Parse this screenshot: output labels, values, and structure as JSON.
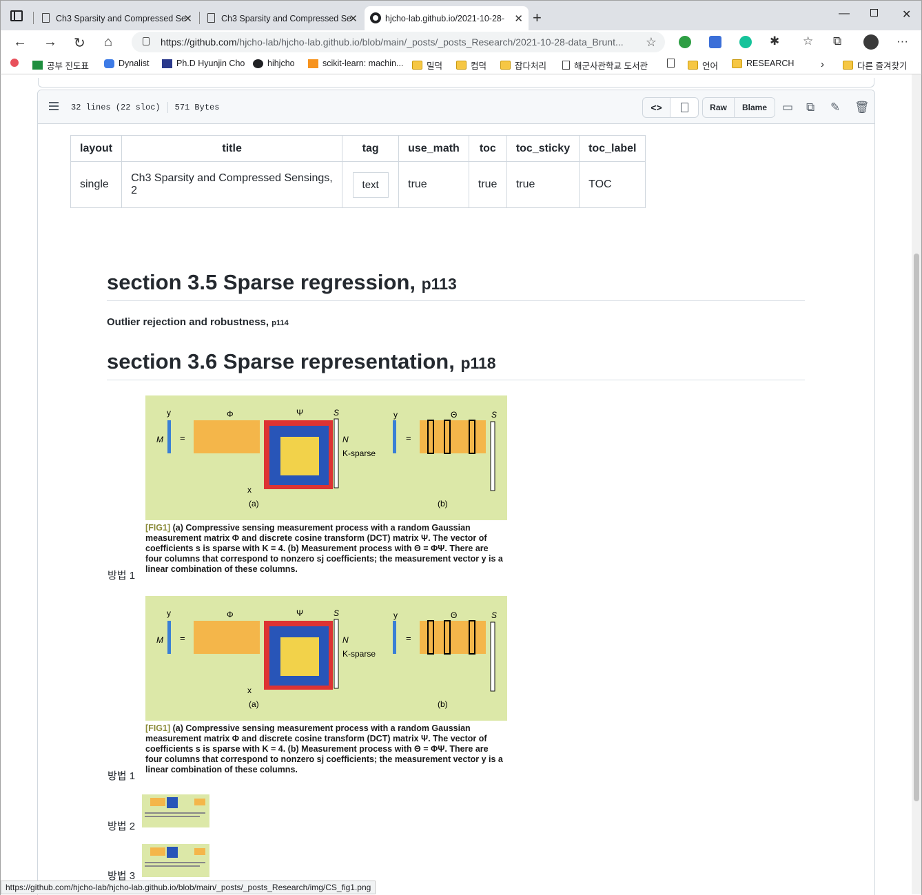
{
  "browser": {
    "tabs": [
      {
        "title": "Ch3 Sparsity and Compressed Se"
      },
      {
        "title": "Ch3 Sparsity and Compressed Se"
      },
      {
        "title": "hjcho-lab.github.io/2021-10-28-"
      }
    ],
    "url_host": "https://github.com",
    "url_path": "/hjcho-lab/hjcho-lab.github.io/blob/main/_posts/_posts_Research/2021-10-28-data_Brunt...",
    "bookmarks": [
      {
        "label": "공부 진도표"
      },
      {
        "label": "Dynalist"
      },
      {
        "label": "Ph.D Hyunjin Cho"
      },
      {
        "label": "hihjcho"
      },
      {
        "label": "scikit-learn: machin..."
      },
      {
        "label": "밀덕"
      },
      {
        "label": "컴덕"
      },
      {
        "label": "잡다처리"
      },
      {
        "label": "해군사관학교 도서관"
      },
      {
        "label": "언어"
      },
      {
        "label": "RESEARCH"
      }
    ],
    "other_bookmarks": "다른 즐겨찾기",
    "status_url": "https://github.com/hjcho-lab/hjcho-lab.github.io/blob/main/_posts/_posts_Research/img/CS_fig1.png"
  },
  "file": {
    "lines": "32 lines (22 sloc)",
    "size": "571 Bytes",
    "raw_label": "Raw",
    "blame_label": "Blame"
  },
  "front_matter": {
    "headers": [
      "layout",
      "title",
      "tag",
      "use_math",
      "toc",
      "toc_sticky",
      "toc_label"
    ],
    "values": [
      "single",
      "Ch3 Sparsity and Compressed Sensings, 2",
      "text",
      "true",
      "true",
      "true",
      "TOC"
    ]
  },
  "sections": {
    "s35_title": "section 3.5 Sparse regression,",
    "s35_page": "p113",
    "s35_sub": "Outlier rejection and robustness,",
    "s35_sub_page": "p114",
    "s36_title": "section 3.6 Sparse representation,",
    "s36_page": "p118"
  },
  "figure": {
    "label_a": "(a)",
    "label_b": "(b)",
    "y": "y",
    "phi": "Φ",
    "psi": "Ψ",
    "s": "S",
    "theta": "Θ",
    "M": "M",
    "N": "N",
    "ksparse": "K-sparse",
    "x": "x",
    "eq": "=",
    "caption_tag": "[FIG1]",
    "caption_text": "(a) Compressive sensing measurement process with a random Gaussian measurement matrix Φ and discrete cosine transform (DCT) matrix Ψ. The vector of coefficients s is sparse with K = 4. (b) Measurement process with Θ = ΦΨ. There are four columns that correspond to nonzero sj coefficients; the measurement vector y is a linear combination of these columns."
  },
  "methods": {
    "m1": "방법 1",
    "m2": "방법 2",
    "m3": "방법 3"
  }
}
